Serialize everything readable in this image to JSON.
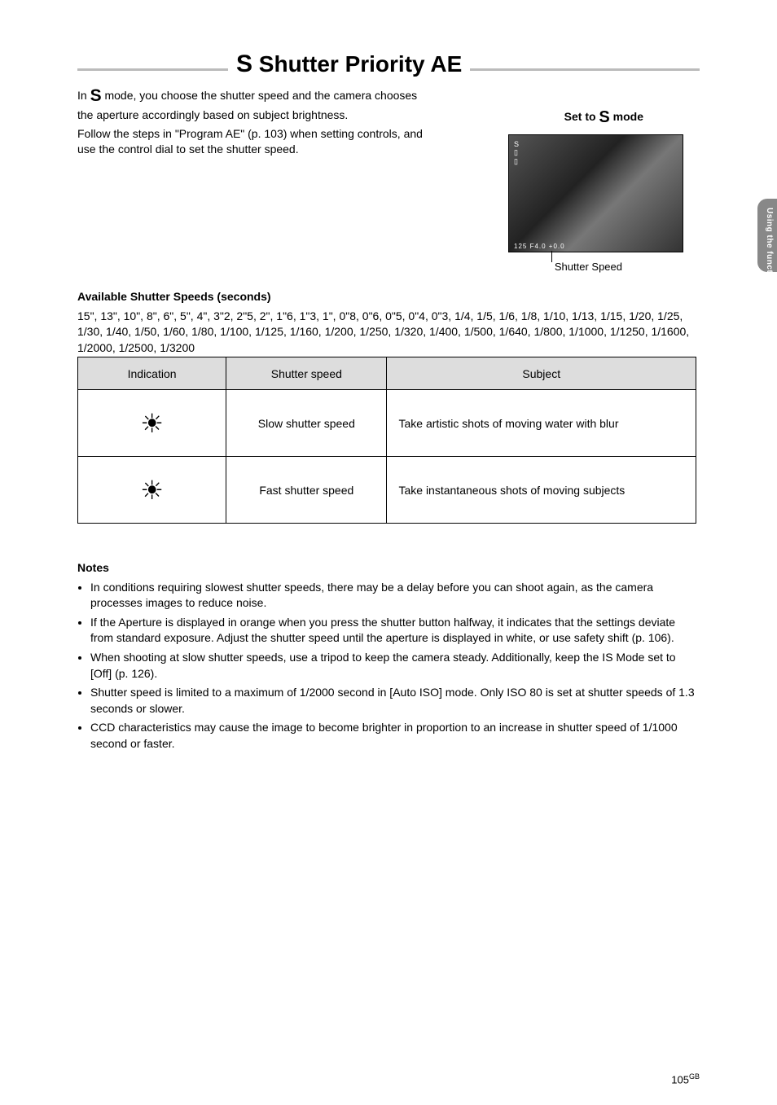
{
  "section": {
    "title_pre": "",
    "title_s": "S",
    "title_rest": " Shutter Priority AE"
  },
  "intro": {
    "line1_pre": "In ",
    "line1_s": "S",
    "line1_post": " mode, you choose the shutter speed and the camera chooses the aperture accordingly based on subject brightness.",
    "line2": "Follow the steps in \"Program AE\" (p. 103) when setting controls, and use the control dial to set the shutter speed."
  },
  "caption": {
    "pre": "Set to ",
    "s": "S",
    "post": " mode"
  },
  "shutter_caption": "Shutter Speed",
  "camera_readout": "125  F4.0  +0.0",
  "available": {
    "title": "Available Shutter Speeds (seconds)",
    "line": "15\", 13\", 10\", 8\", 6\", 5\", 4\", 3\"2, 2\"5, 2\", 1\"6, 1\"3, 1\", 0\"8, 0\"6, 0\"5, 0\"4, 0\"3, 1/4, 1/5, 1/6, 1/8, 1/10, 1/13, 1/15, 1/20, 1/25, 1/30, 1/40, 1/50, 1/60, 1/80, 1/100, 1/125, 1/160, 1/200, 1/250, 1/320, 1/400, 1/500, 1/640, 1/800, 1/1000, 1/1250, 1/1600, 1/2000, 1/2500, 1/3200"
  },
  "table": {
    "headers": [
      "Indication",
      "Shutter speed",
      "Subject"
    ],
    "rows": [
      {
        "icon": "sun",
        "speed": "Slow shutter speed",
        "subject": "Take artistic shots of moving water with blur"
      },
      {
        "icon": "sun",
        "speed": "Fast shutter speed",
        "subject": "Take instantaneous shots of moving subjects"
      }
    ]
  },
  "notes": {
    "title": "Notes",
    "items": [
      "In conditions requiring slowest shutter speeds, there may be a delay before you can shoot again, as the camera processes images to reduce noise.",
      "If the Aperture is displayed in orange when you press the shutter button halfway, it indicates that the settings deviate from standard exposure. Adjust the shutter speed until the aperture is displayed in white, or use safety shift (p. 106).",
      "When shooting at slow shutter speeds, use a tripod to keep the camera steady. Additionally, keep the IS Mode set to [Off] (p. 126).",
      "Shutter speed is limited to a maximum of 1/2000 second in [Auto ISO] mode. Only ISO 80 is set at shutter speeds of 1.3 seconds or slower.",
      "CCD characteristics may cause the image to become brighter in proportion to an increase in shutter speed of 1/1000 second or faster."
    ]
  },
  "side_tab": "Using the function",
  "page": {
    "num": "105",
    "gb": "GB"
  }
}
